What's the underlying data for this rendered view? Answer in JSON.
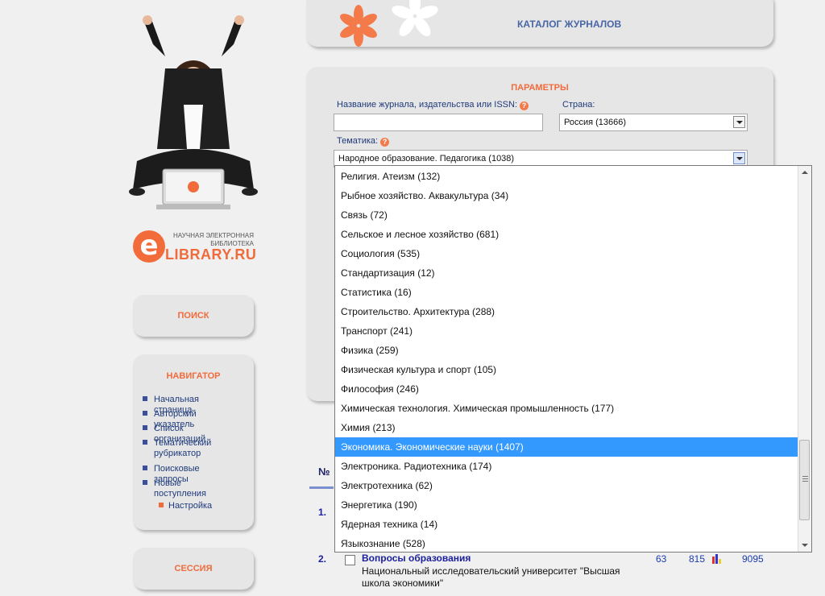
{
  "header": {
    "catalog_title": "КАТАЛОГ ЖУРНАЛОВ"
  },
  "logo": {
    "line1": "НАУЧНАЯ ЭЛЕКТРОННАЯ",
    "line2": "БИБЛИОТЕКА",
    "brand": "LIBRARY.RU"
  },
  "sidebar": {
    "search_label": "ПОИСК",
    "navigator_title": "НАВИГАТОР",
    "nav_items": [
      {
        "label": "Начальная страница"
      },
      {
        "label": "Авторский указатель"
      },
      {
        "label": "Список организаций"
      },
      {
        "label": "Тематический рубрикатор"
      },
      {
        "label": "Поисковые запросы"
      },
      {
        "label": "Новые поступления"
      }
    ],
    "settings_label": "Настройка",
    "session_label": "СЕССИЯ"
  },
  "params": {
    "title": "ПАРАМЕТРЫ",
    "journal_label": "Название журнала, издательства или ISSN:",
    "journal_value": "",
    "country_label": "Страна:",
    "country_value": "Россия  (13666)",
    "topic_label": "Тематика:",
    "topic_value": "Народное образование. Педагогика  (1038)"
  },
  "dropdown": {
    "options": [
      "Религия. Атеизм  (132)",
      "Рыбное хозяйство. Аквакультура  (34)",
      "Связь  (72)",
      "Сельское и лесное хозяйство  (681)",
      "Социология  (535)",
      "Стандартизация  (12)",
      "Статистика  (16)",
      "Строительство. Архитектура  (288)",
      "Транспорт  (241)",
      "Физика  (259)",
      "Физическая культура и спорт  (105)",
      "Философия  (246)",
      "Химическая технология. Химическая промышленность  (177)",
      "Химия  (213)",
      "Экономика. Экономические науки  (1407)",
      "Электроника. Радиотехника  (174)",
      "Электротехника  (62)",
      "Энергетика  (190)",
      "Ядерная техника  (14)",
      "Языкознание  (528)"
    ],
    "selected_index": 14
  },
  "results": {
    "col_no": "№",
    "row1_no": "1.",
    "row2": {
      "no": "2.",
      "title": "Вопросы образования",
      "publisher": "Национальный исследовательский университет \"Высшая школа экономики\"",
      "v1": "63",
      "v2": "815",
      "v3": "9095"
    }
  },
  "colors": {
    "accent": "#f26b3a",
    "link": "#1e3a7b",
    "selection": "#3399ff"
  }
}
